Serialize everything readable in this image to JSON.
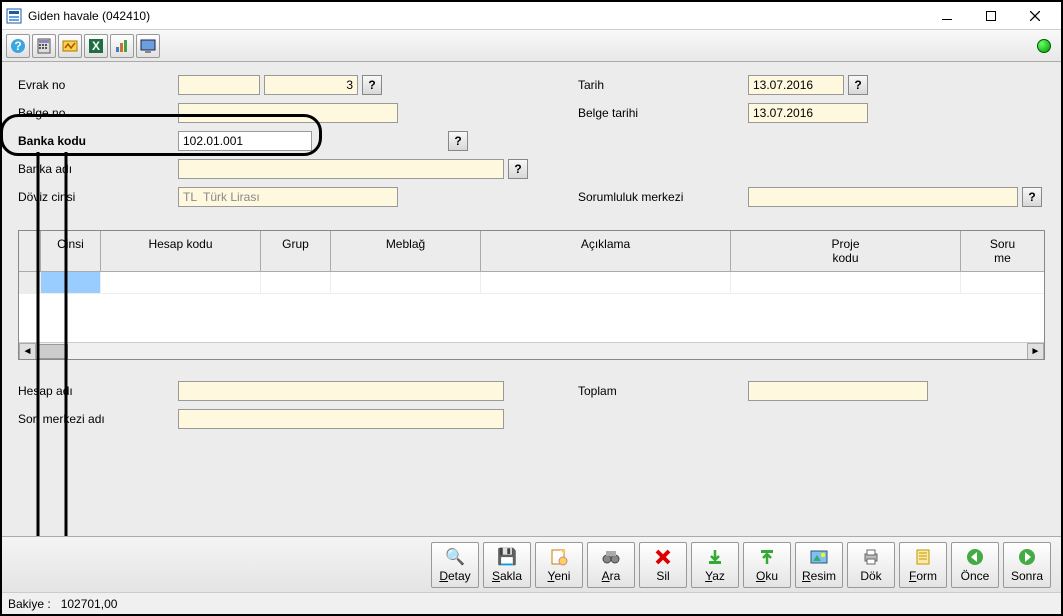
{
  "window": {
    "title": "Giden havale (042410)"
  },
  "form": {
    "evrak_no_label": "Evrak no",
    "evrak_no_a": "",
    "evrak_no_b": "3",
    "belge_no_label": "Belge no",
    "belge_no": "",
    "banka_kodu_label": "Banka      kodu",
    "banka_kodu": "102.01.001",
    "banka_adi_label": "Banka      adı",
    "banka_adi": "",
    "doviz_cinsi_label": "Döviz cinsi",
    "doviz_cinsi": "TL  Türk Lirası",
    "tarih_label": "Tarih",
    "tarih": "13.07.2016",
    "belge_tarihi_label": "Belge tarihi",
    "belge_tarihi": "13.07.2016",
    "sorumluluk_label": "Sorumluluk merkezi",
    "sorumluluk": "",
    "hesap_adi_label": "Hesap adı",
    "hesap_adi": "",
    "sor_merkezi_label": "Sor. merkezi adı",
    "sor_merkezi": "",
    "toplam_label": "Toplam",
    "toplam": ""
  },
  "grid": {
    "cols": {
      "c0": "",
      "c1": "Cinsi",
      "c2": "Hesap kodu",
      "c3": "Grup",
      "c4": "Meblağ",
      "c5": "Açıklama",
      "c6": "Proje\nkodu",
      "c7": "Soru\nme"
    }
  },
  "actions": {
    "detay": "Detay",
    "sakla": "Sakla",
    "yeni": "Yeni",
    "ara": "Ara",
    "sil": "Sil",
    "yaz": "Yaz",
    "oku": "Oku",
    "resim": "Resim",
    "dok": "Dök",
    "form": "Form",
    "once": "Önce",
    "sonra": "Sonra"
  },
  "status": {
    "bakiye_label": "Bakiye :",
    "bakiye_value": "102701,00"
  },
  "q": "?"
}
